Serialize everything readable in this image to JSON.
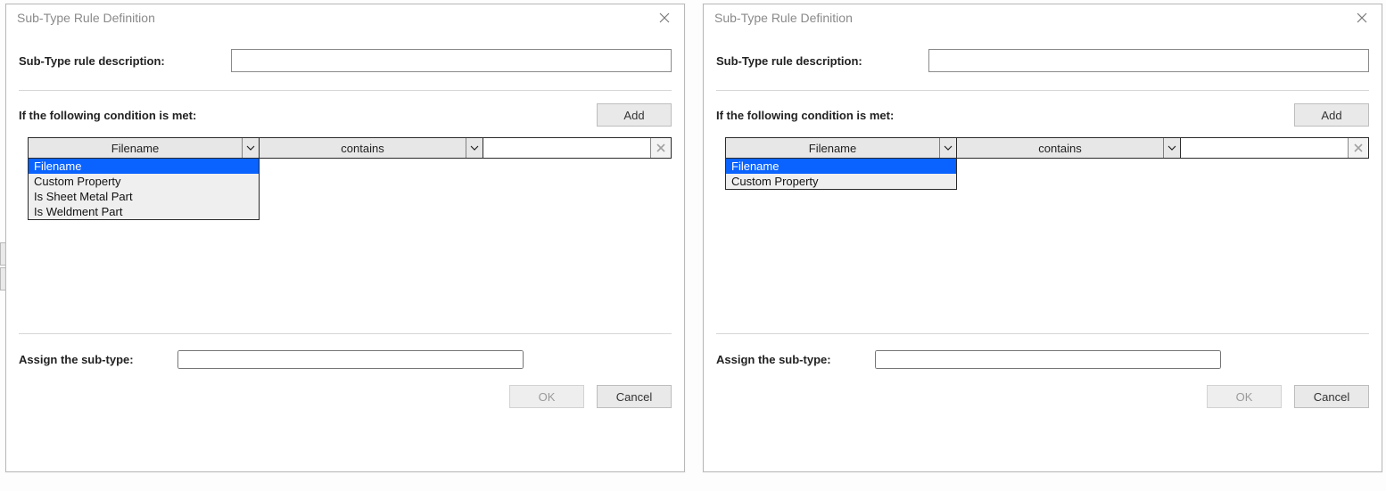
{
  "left_dialog": {
    "title": "Sub-Type Rule Definition",
    "desc_label": "Sub-Type rule description:",
    "desc_value": "",
    "cond_label": "If the following condition is met:",
    "add_button": "Add",
    "row": {
      "field_selected": "Filename",
      "operator_selected": "contains",
      "value": ""
    },
    "field_options": [
      "Filename",
      "Custom Property",
      "Is Sheet Metal Part",
      "Is Weldment Part"
    ],
    "assign_label": "Assign the sub-type:",
    "assign_value": "",
    "ok_button": "OK",
    "cancel_button": "Cancel"
  },
  "right_dialog": {
    "title": "Sub-Type Rule Definition",
    "desc_label": "Sub-Type rule description:",
    "desc_value": "",
    "cond_label": "If the following condition is met:",
    "add_button": "Add",
    "row": {
      "field_selected": "Filename",
      "operator_selected": "contains",
      "value": ""
    },
    "field_options": [
      "Filename",
      "Custom Property"
    ],
    "assign_label": "Assign the sub-type:",
    "assign_value": "",
    "ok_button": "OK",
    "cancel_button": "Cancel"
  }
}
